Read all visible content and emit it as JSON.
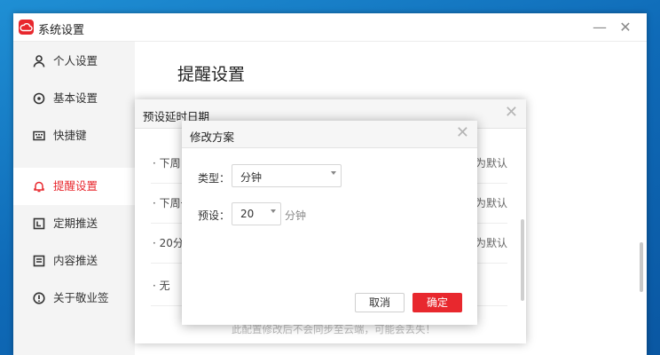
{
  "window": {
    "title": "系统设置"
  },
  "sidebar": {
    "items": [
      {
        "label": "个人设置",
        "icon": "person-icon"
      },
      {
        "label": "基本设置",
        "icon": "gear-icon"
      },
      {
        "label": "快捷键",
        "icon": "keyboard-icon"
      },
      {
        "label": "提醒设置",
        "icon": "bell-icon",
        "active": true
      },
      {
        "label": "定期推送",
        "icon": "calendar-icon"
      },
      {
        "label": "内容推送",
        "icon": "document-icon"
      },
      {
        "label": "关于敬业签",
        "icon": "info-icon"
      }
    ]
  },
  "main": {
    "title": "提醒设置"
  },
  "dialog_delay": {
    "title": "预设延时日期",
    "rows": [
      {
        "text": "· 下周",
        "default_text": "为默认"
      },
      {
        "text": "· 下周一",
        "default_text": "为默认"
      },
      {
        "text": "· 20分钟",
        "default_text": "为默认"
      },
      {
        "text": "· 无",
        "default_text": ""
      }
    ],
    "footnote": "此配置修改后不会同步至云端，可能会丢失！"
  },
  "dialog_edit": {
    "title": "修改方案",
    "type_label": "类型：",
    "type_value": "分钟",
    "preset_label": "预设：",
    "preset_value": "20",
    "preset_unit": "分钟",
    "cancel_label": "取消",
    "confirm_label": "确定"
  },
  "colors": {
    "accent": "#e8282e",
    "background": "#1a7fc8"
  }
}
